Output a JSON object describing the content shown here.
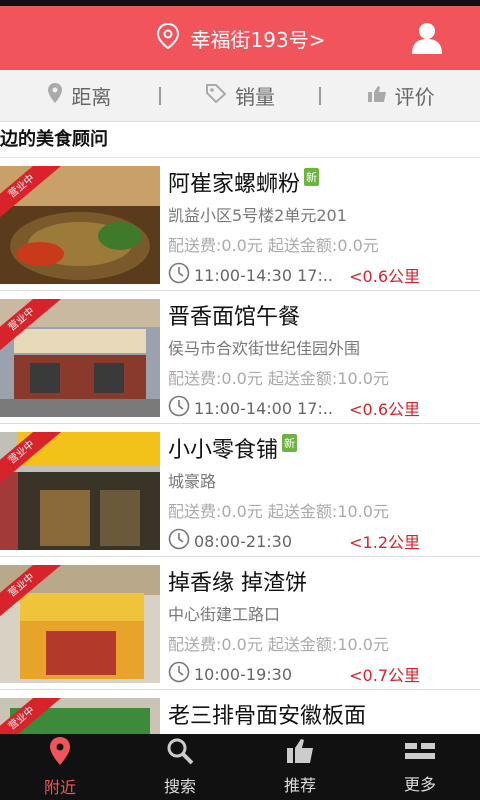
{
  "header": {
    "location": "幸福街193号>",
    "accent": "#f2545b"
  },
  "filters": [
    {
      "label": "距离",
      "icon": "location-pin-icon"
    },
    {
      "label": "销量",
      "icon": "tag-icon"
    },
    {
      "label": "评价",
      "icon": "thumbs-up-icon"
    }
  ],
  "section_title": "边的美食顾问",
  "ribbon": "营业中",
  "restaurants": [
    {
      "name": "阿崔家螺蛳粉",
      "new": "新",
      "address": "凯益小区5号楼2单元201",
      "fees": "配送费:0.0元  起送金额:0.0元",
      "hours": "11:00-14:30  17:..",
      "distance": "<0.6公里"
    },
    {
      "name": "晋香面馆午餐",
      "new": "",
      "address": "侯马市合欢街世纪佳园外围",
      "fees": "配送费:0.0元  起送金额:10.0元",
      "hours": "11:00-14:00  17:..",
      "distance": "<0.6公里"
    },
    {
      "name": "小小零食铺",
      "new": "新",
      "address": "城豪路",
      "fees": "配送费:0.0元  起送金额:10.0元",
      "hours": "08:00-21:30",
      "distance": "<1.2公里"
    },
    {
      "name": "掉香缘 掉渣饼",
      "new": "",
      "address": "中心街建工路口",
      "fees": "配送费:0.0元  起送金额:10.0元",
      "hours": "10:00-19:30",
      "distance": "<0.7公里"
    },
    {
      "name": "老三排骨面安徽板面",
      "new": "",
      "address": "",
      "fees": "",
      "hours": "",
      "distance": ""
    }
  ],
  "tabs": [
    {
      "label": "附近",
      "icon": "location-pin-icon"
    },
    {
      "label": "搜索",
      "icon": "search-icon"
    },
    {
      "label": "推荐",
      "icon": "thumbs-up-icon"
    },
    {
      "label": "更多",
      "icon": "more-icon"
    }
  ]
}
